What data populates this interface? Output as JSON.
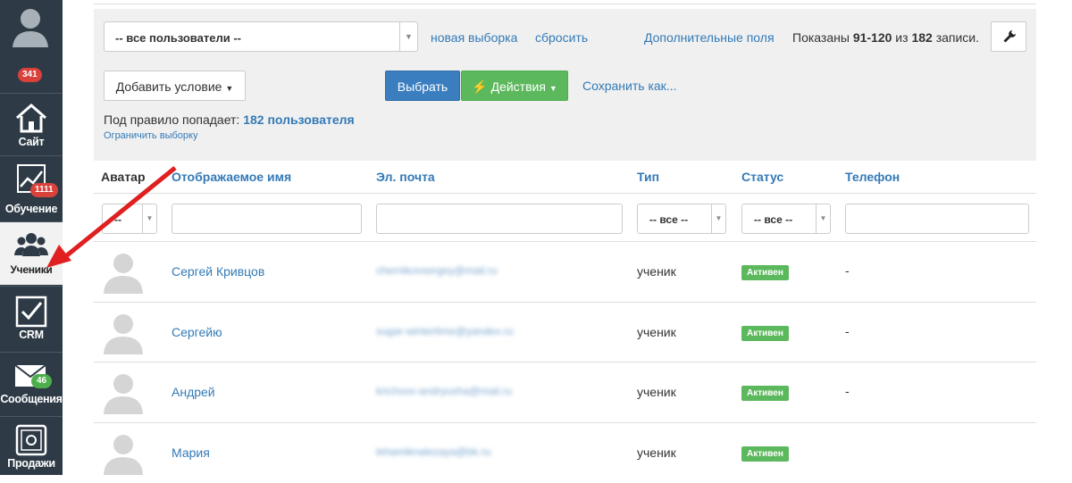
{
  "sidebar": {
    "profile_badge": "341",
    "items": [
      {
        "label": "Сайт",
        "icon": "home-icon"
      },
      {
        "label": "Обучение",
        "icon": "chart-icon",
        "badge": "1111"
      },
      {
        "label": "Ученики",
        "icon": "users-icon"
      },
      {
        "label": "CRM",
        "icon": "checkbox-icon"
      },
      {
        "label": "Сообщения",
        "icon": "envelope-icon",
        "badge": "46"
      },
      {
        "label": "Продажи",
        "icon": "safe-icon"
      }
    ]
  },
  "filter": {
    "user_select": "-- все пользователи --",
    "new_selection": "новая выборка",
    "reset": "сбросить",
    "extra_fields": "Дополнительные поля",
    "shown_prefix": "Показаны",
    "shown_range": "91-120",
    "shown_of": "из",
    "shown_total": "182",
    "shown_suffix": "записи.",
    "add_condition": "Добавить условие",
    "select_btn": "Выбрать",
    "actions_btn": "Действия",
    "save_as": "Сохранить как...",
    "rule_text": "Под правило попадает:",
    "rule_count": "182 пользователя",
    "limit_link": "Ограничить выборку"
  },
  "table": {
    "headers": {
      "avatar": "Аватар",
      "name": "Отображаемое имя",
      "email": "Эл. почта",
      "type": "Тип",
      "status": "Статус",
      "phone": "Телефон"
    },
    "filters": {
      "avatar": "--",
      "type": "-- все --",
      "status": "-- все --"
    },
    "rows": [
      {
        "name": "Сергей Кривцов",
        "email": "chernikovsergey@mail.ru",
        "type": "ученик",
        "status": "Активен",
        "phone": "-"
      },
      {
        "name": "Сергейю",
        "email": "sugar-wintertime@yandex.ru",
        "type": "ученик",
        "status": "Активен",
        "phone": "-"
      },
      {
        "name": "Андрей",
        "email": "krichsov-andryusha@mail.ru",
        "type": "ученик",
        "status": "Активен",
        "phone": "-"
      },
      {
        "name": "Мария",
        "email": "lehamiknalezaya@bk.ru",
        "type": "ученик",
        "status": "Активен",
        "phone": ""
      }
    ]
  },
  "colors": {
    "sidebar_bg": "#2e3b47",
    "link": "#337ab7",
    "primary_btn": "#3a7ec0",
    "success": "#5cb85c",
    "badge_red": "#d9413b",
    "arrow": "#e02020"
  }
}
